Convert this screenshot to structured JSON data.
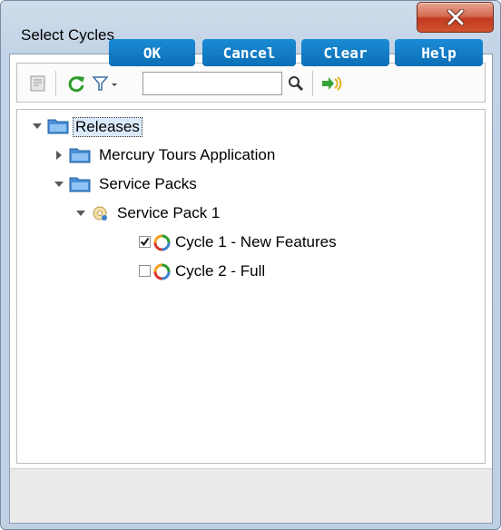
{
  "window": {
    "title": "Select Cycles"
  },
  "toolbar": {
    "search_value": ""
  },
  "tree": {
    "root": "Releases",
    "mercury": "Mercury Tours Application",
    "service_packs": "Service Packs",
    "service_pack_1": "Service Pack 1",
    "cycle1": {
      "label": "Cycle 1 - New Features",
      "checked": true
    },
    "cycle2": {
      "label": "Cycle 2 - Full",
      "checked": false
    }
  },
  "buttons": {
    "ok": "OK",
    "cancel": "Cancel",
    "clear": "Clear",
    "help": "Help"
  },
  "colors": {
    "button_blue": "#0b6fb6",
    "selection": "#dbeafb",
    "close_red": "#c23a21"
  },
  "icons": [
    "close-icon",
    "notes-icon",
    "refresh-icon",
    "filter-icon",
    "search-icon",
    "go-to-icon",
    "folder-icon",
    "release-icon",
    "cycle-icon",
    "checkmark-icon"
  ]
}
